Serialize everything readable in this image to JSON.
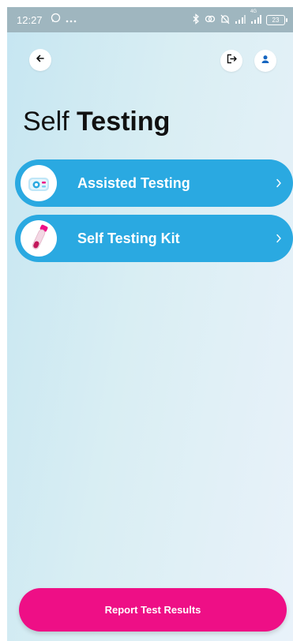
{
  "status_bar": {
    "time": "12:27",
    "battery": "23",
    "network": "4G"
  },
  "header": {
    "back_icon": "arrow-left-icon",
    "logout_icon": "logout-icon",
    "profile_icon": "user-icon"
  },
  "page": {
    "title_light": "Self",
    "title_bold": "Testing"
  },
  "menu": {
    "items": [
      {
        "label": "Assisted Testing",
        "icon": "assisted-testing-icon"
      },
      {
        "label": "Self Testing Kit",
        "icon": "test-kit-icon"
      }
    ]
  },
  "footer": {
    "report_label": "Report Test Results"
  },
  "colors": {
    "accent_blue": "#2aa9e1",
    "accent_pink": "#ee0f86"
  }
}
